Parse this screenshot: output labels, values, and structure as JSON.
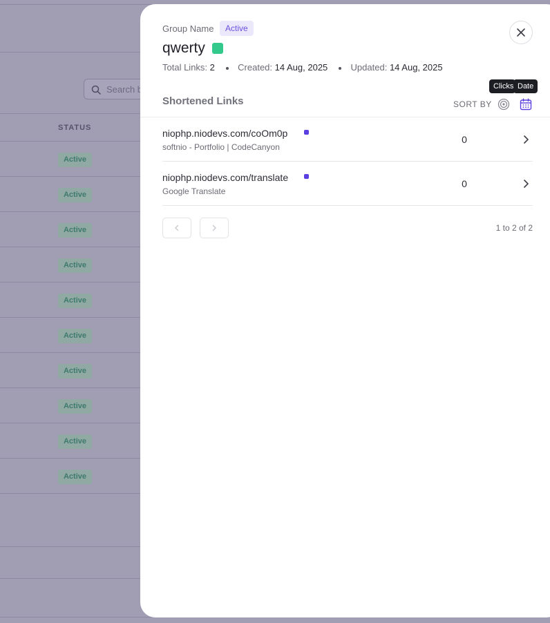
{
  "background": {
    "search_placeholder": "Search b",
    "status_header": "STATUS",
    "rows": [
      {
        "status": "Active"
      },
      {
        "status": "Active"
      },
      {
        "status": "Active"
      },
      {
        "status": "Active"
      },
      {
        "status": "Active"
      },
      {
        "status": "Active"
      },
      {
        "status": "Active"
      },
      {
        "status": "Active"
      },
      {
        "status": "Active"
      },
      {
        "status": "Active"
      }
    ]
  },
  "modal": {
    "group_label": "Group Name",
    "status": "Active",
    "title": "qwerty",
    "color": "#34c98c",
    "meta": {
      "total_links_label": "Total Links:",
      "total_links": "2",
      "created_label": "Created:",
      "created": "14 Aug, 2025",
      "updated_label": "Updated:",
      "updated": "14 Aug, 2025"
    },
    "section_title": "Shortened Links",
    "sort_by_label": "SORT BY",
    "sort_options": {
      "clicks": {
        "tooltip": "Clicks",
        "icon": "target-icon"
      },
      "date": {
        "tooltip": "Date",
        "icon": "calendar-icon",
        "active": true
      }
    },
    "links": [
      {
        "url": "niophp.niodevs.com/coOm0p",
        "title": "softnio - Portfolio | CodeCanyon",
        "clicks": "0"
      },
      {
        "url": "niophp.niodevs.com/translate",
        "title": "Google Translate",
        "clicks": "0"
      }
    ],
    "pagination": {
      "info": "1 to 2 of 2"
    }
  },
  "colors": {
    "accent": "#5b3fe0",
    "overlay": "#a19eb4",
    "badge_text": "#3f7a6e"
  }
}
